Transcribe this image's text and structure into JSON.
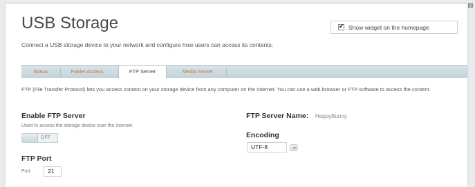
{
  "page": {
    "title": "USB Storage",
    "subtitle": "Connect a USB storage device to your network and configure how users can access its contents.",
    "widget_label": "Show widget on the homepage",
    "widget_checked": true
  },
  "tabs": [
    {
      "label": "Status",
      "active": false
    },
    {
      "label": "Folder Access",
      "active": false
    },
    {
      "label": "FTP Server",
      "active": true
    },
    {
      "label": "Media Server",
      "active": false
    }
  ],
  "ftp": {
    "description": "FTP (File Transfer Protocol) lets you access content on your storage device from any computer on the Internet. You can use a web browser or FTP software to access the content.",
    "enable_heading": "Enable FTP Server",
    "enable_help": "Used to access the storage device over the Internet.",
    "toggle_state": "OFF",
    "port_heading": "FTP Port",
    "port_label": "Port",
    "port_value": "21",
    "server_name_label": "FTP Server Name:",
    "server_name_value": "HappyBunny",
    "encoding_label": "Encoding",
    "encoding_value": "UTF-8"
  },
  "colors": {
    "tab_inactive": "#b97a3a",
    "tabbar_bg": "#c3d2da",
    "accent": "#333333"
  },
  "icons": {
    "close": "close-icon",
    "checkbox": "checkmark-icon",
    "dropdown": "chevron-down-icon"
  }
}
